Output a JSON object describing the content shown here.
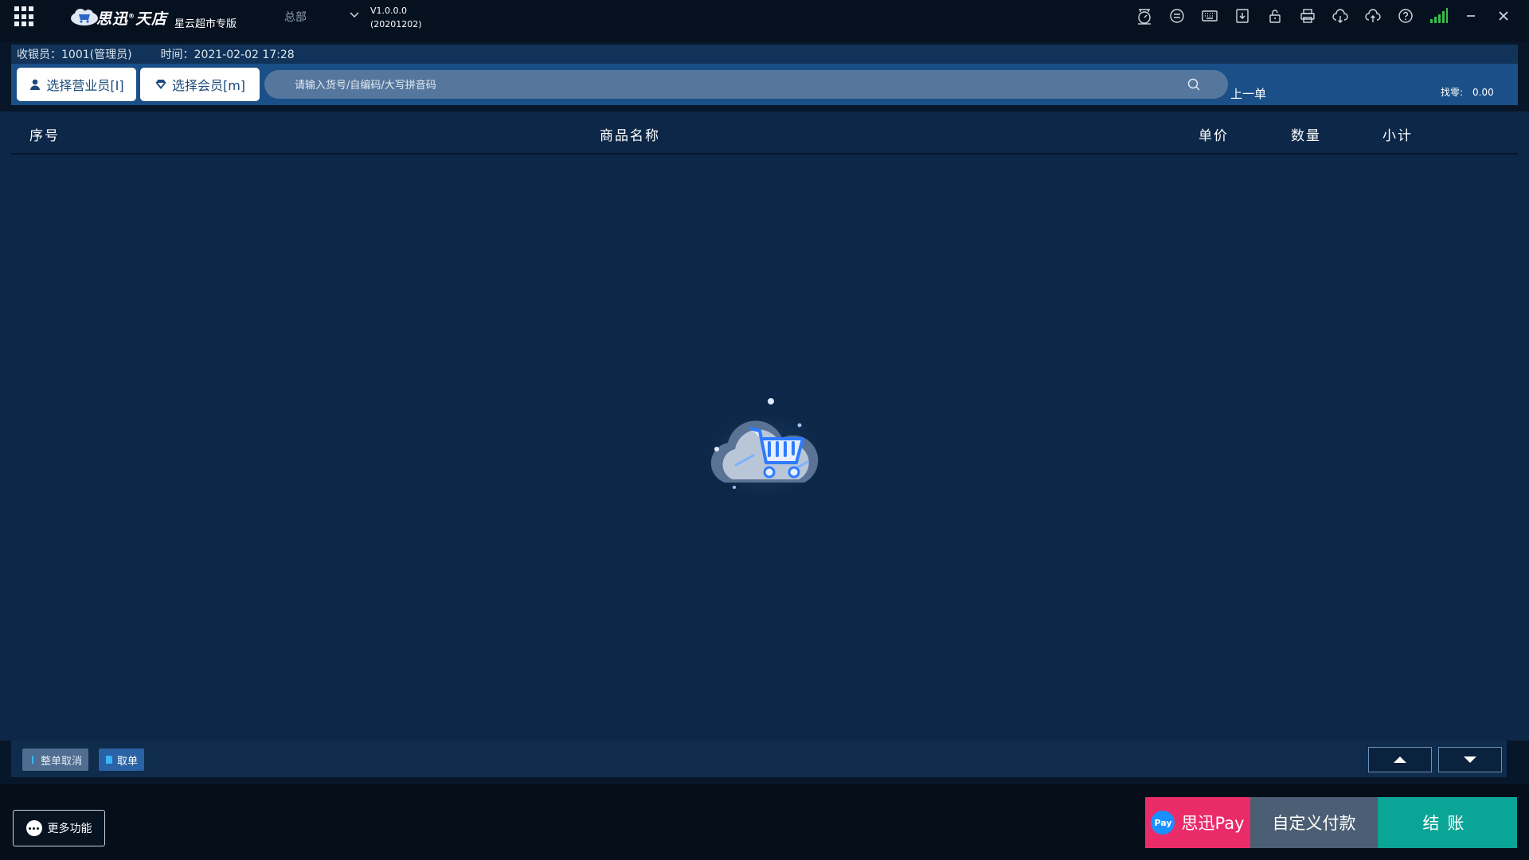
{
  "titlebar": {
    "brand": "思迅",
    "brand_suffix": "天店",
    "edition": "星云超市专版",
    "store": "总部",
    "version": "V1.0.0.0",
    "build": "(20201202)"
  },
  "toolbar_icons": [
    "scale-icon",
    "cash-drawer-icon",
    "keyboard-icon",
    "download-icon",
    "lock-icon",
    "printer-icon",
    "cloud-download-icon",
    "cloud-upload-icon",
    "help-icon",
    "signal-icon",
    "minimize-icon",
    "close-icon"
  ],
  "info": {
    "cashier": "收银员：1001(管理员)",
    "time": "时间：2021-02-02 17:28"
  },
  "actions": {
    "select_staff": "选择营业员[I]",
    "select_member": "选择会员[m]",
    "search_placeholder": "请输入货号/自编码/大写拼音码",
    "prev_order": "上一单",
    "change_label": "找零:",
    "change_value": "0.00"
  },
  "table": {
    "columns": [
      "序号",
      "商品名称",
      "单价",
      "数量",
      "小计"
    ],
    "rows": []
  },
  "bottom": {
    "cancel_all": "整单取消",
    "take_order": "取单"
  },
  "footer": {
    "more": "更多功能",
    "pay_badge": "Pay",
    "pay_sixun": "思迅Pay",
    "pay_custom": "自定义付款",
    "checkout": "结账"
  },
  "colors": {
    "background": "#0c2747",
    "titlebar": "#061120",
    "accent_pink": "#ea2b6a",
    "accent_teal": "#0aa596",
    "accent_blue": "#1a4f87"
  }
}
